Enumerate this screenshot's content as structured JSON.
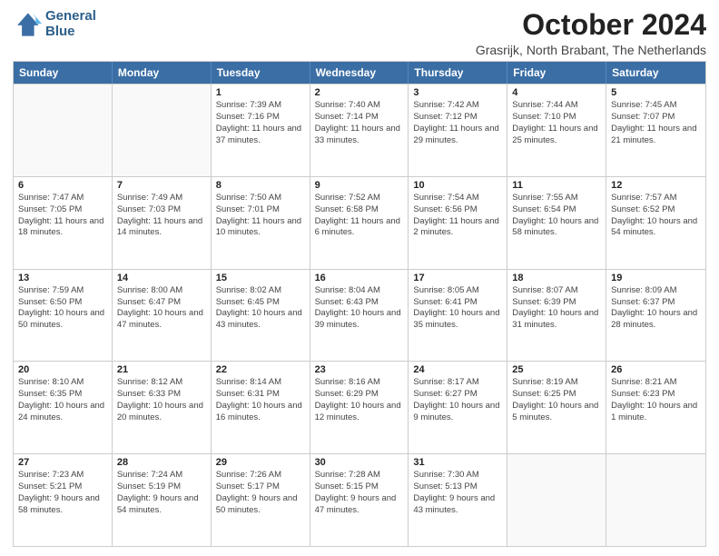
{
  "header": {
    "logo_line1": "General",
    "logo_line2": "Blue",
    "month_title": "October 2024",
    "subtitle": "Grasrijk, North Brabant, The Netherlands"
  },
  "weekdays": [
    "Sunday",
    "Monday",
    "Tuesday",
    "Wednesday",
    "Thursday",
    "Friday",
    "Saturday"
  ],
  "weeks": [
    [
      {
        "day": "",
        "info": "",
        "empty": true
      },
      {
        "day": "",
        "info": "",
        "empty": true
      },
      {
        "day": "1",
        "info": "Sunrise: 7:39 AM\nSunset: 7:16 PM\nDaylight: 11 hours and 37 minutes.",
        "empty": false
      },
      {
        "day": "2",
        "info": "Sunrise: 7:40 AM\nSunset: 7:14 PM\nDaylight: 11 hours and 33 minutes.",
        "empty": false
      },
      {
        "day": "3",
        "info": "Sunrise: 7:42 AM\nSunset: 7:12 PM\nDaylight: 11 hours and 29 minutes.",
        "empty": false
      },
      {
        "day": "4",
        "info": "Sunrise: 7:44 AM\nSunset: 7:10 PM\nDaylight: 11 hours and 25 minutes.",
        "empty": false
      },
      {
        "day": "5",
        "info": "Sunrise: 7:45 AM\nSunset: 7:07 PM\nDaylight: 11 hours and 21 minutes.",
        "empty": false
      }
    ],
    [
      {
        "day": "6",
        "info": "Sunrise: 7:47 AM\nSunset: 7:05 PM\nDaylight: 11 hours and 18 minutes.",
        "empty": false
      },
      {
        "day": "7",
        "info": "Sunrise: 7:49 AM\nSunset: 7:03 PM\nDaylight: 11 hours and 14 minutes.",
        "empty": false
      },
      {
        "day": "8",
        "info": "Sunrise: 7:50 AM\nSunset: 7:01 PM\nDaylight: 11 hours and 10 minutes.",
        "empty": false
      },
      {
        "day": "9",
        "info": "Sunrise: 7:52 AM\nSunset: 6:58 PM\nDaylight: 11 hours and 6 minutes.",
        "empty": false
      },
      {
        "day": "10",
        "info": "Sunrise: 7:54 AM\nSunset: 6:56 PM\nDaylight: 11 hours and 2 minutes.",
        "empty": false
      },
      {
        "day": "11",
        "info": "Sunrise: 7:55 AM\nSunset: 6:54 PM\nDaylight: 10 hours and 58 minutes.",
        "empty": false
      },
      {
        "day": "12",
        "info": "Sunrise: 7:57 AM\nSunset: 6:52 PM\nDaylight: 10 hours and 54 minutes.",
        "empty": false
      }
    ],
    [
      {
        "day": "13",
        "info": "Sunrise: 7:59 AM\nSunset: 6:50 PM\nDaylight: 10 hours and 50 minutes.",
        "empty": false
      },
      {
        "day": "14",
        "info": "Sunrise: 8:00 AM\nSunset: 6:47 PM\nDaylight: 10 hours and 47 minutes.",
        "empty": false
      },
      {
        "day": "15",
        "info": "Sunrise: 8:02 AM\nSunset: 6:45 PM\nDaylight: 10 hours and 43 minutes.",
        "empty": false
      },
      {
        "day": "16",
        "info": "Sunrise: 8:04 AM\nSunset: 6:43 PM\nDaylight: 10 hours and 39 minutes.",
        "empty": false
      },
      {
        "day": "17",
        "info": "Sunrise: 8:05 AM\nSunset: 6:41 PM\nDaylight: 10 hours and 35 minutes.",
        "empty": false
      },
      {
        "day": "18",
        "info": "Sunrise: 8:07 AM\nSunset: 6:39 PM\nDaylight: 10 hours and 31 minutes.",
        "empty": false
      },
      {
        "day": "19",
        "info": "Sunrise: 8:09 AM\nSunset: 6:37 PM\nDaylight: 10 hours and 28 minutes.",
        "empty": false
      }
    ],
    [
      {
        "day": "20",
        "info": "Sunrise: 8:10 AM\nSunset: 6:35 PM\nDaylight: 10 hours and 24 minutes.",
        "empty": false
      },
      {
        "day": "21",
        "info": "Sunrise: 8:12 AM\nSunset: 6:33 PM\nDaylight: 10 hours and 20 minutes.",
        "empty": false
      },
      {
        "day": "22",
        "info": "Sunrise: 8:14 AM\nSunset: 6:31 PM\nDaylight: 10 hours and 16 minutes.",
        "empty": false
      },
      {
        "day": "23",
        "info": "Sunrise: 8:16 AM\nSunset: 6:29 PM\nDaylight: 10 hours and 12 minutes.",
        "empty": false
      },
      {
        "day": "24",
        "info": "Sunrise: 8:17 AM\nSunset: 6:27 PM\nDaylight: 10 hours and 9 minutes.",
        "empty": false
      },
      {
        "day": "25",
        "info": "Sunrise: 8:19 AM\nSunset: 6:25 PM\nDaylight: 10 hours and 5 minutes.",
        "empty": false
      },
      {
        "day": "26",
        "info": "Sunrise: 8:21 AM\nSunset: 6:23 PM\nDaylight: 10 hours and 1 minute.",
        "empty": false
      }
    ],
    [
      {
        "day": "27",
        "info": "Sunrise: 7:23 AM\nSunset: 5:21 PM\nDaylight: 9 hours and 58 minutes.",
        "empty": false
      },
      {
        "day": "28",
        "info": "Sunrise: 7:24 AM\nSunset: 5:19 PM\nDaylight: 9 hours and 54 minutes.",
        "empty": false
      },
      {
        "day": "29",
        "info": "Sunrise: 7:26 AM\nSunset: 5:17 PM\nDaylight: 9 hours and 50 minutes.",
        "empty": false
      },
      {
        "day": "30",
        "info": "Sunrise: 7:28 AM\nSunset: 5:15 PM\nDaylight: 9 hours and 47 minutes.",
        "empty": false
      },
      {
        "day": "31",
        "info": "Sunrise: 7:30 AM\nSunset: 5:13 PM\nDaylight: 9 hours and 43 minutes.",
        "empty": false
      },
      {
        "day": "",
        "info": "",
        "empty": true
      },
      {
        "day": "",
        "info": "",
        "empty": true
      }
    ]
  ]
}
